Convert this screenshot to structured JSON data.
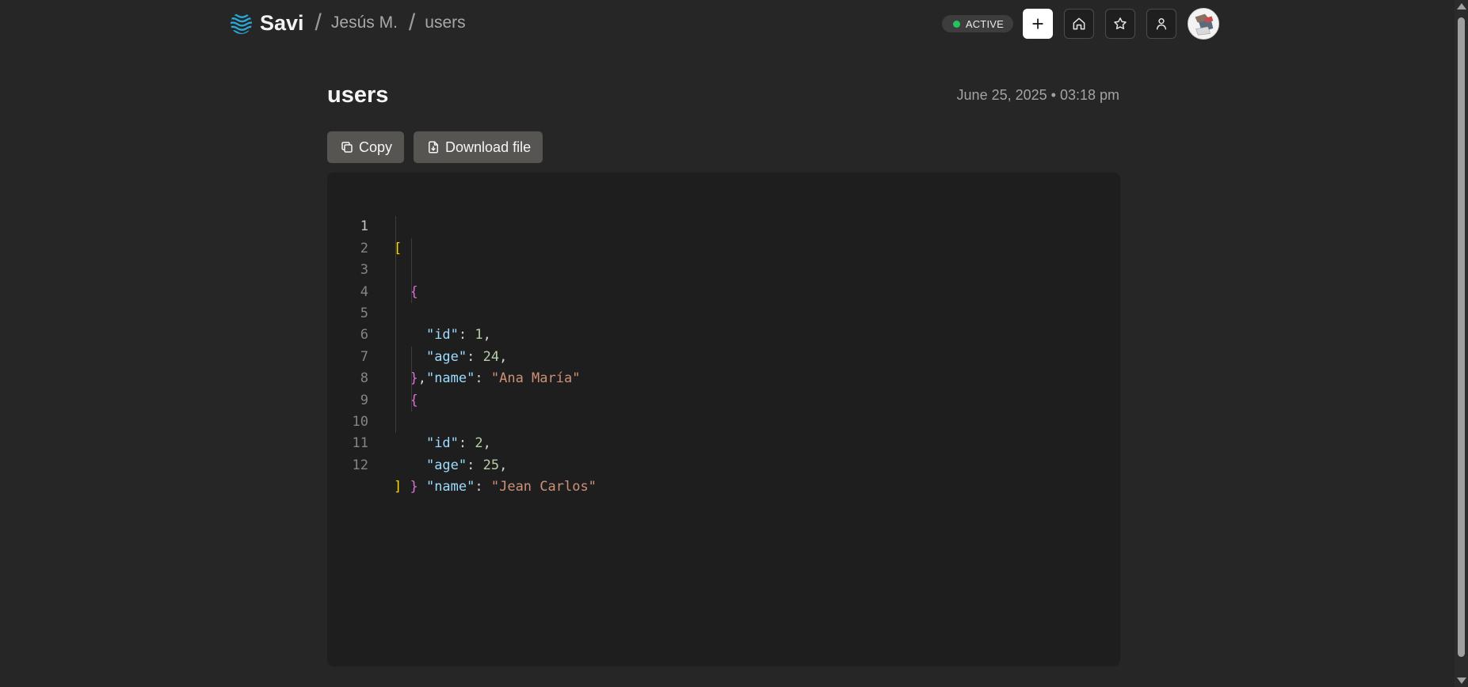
{
  "header": {
    "brand": "Savi",
    "breadcrumb": [
      "Jesús M.",
      "users"
    ],
    "status": "ACTIVE",
    "status_color": "#22c55e",
    "icons": [
      "plus-icon",
      "home-icon",
      "star-icon",
      "user-icon"
    ]
  },
  "page": {
    "title": "users",
    "timestamp": "June 25, 2025 • 03:18 pm"
  },
  "toolbar": {
    "copy_label": "Copy",
    "download_label": "Download file"
  },
  "code": {
    "line_numbers": [
      "1",
      "2",
      "3",
      "4",
      "5",
      "6",
      "7",
      "8",
      "9",
      "10",
      "11",
      "12"
    ],
    "tokens": {
      "open_array": "[",
      "close_array": "]",
      "open_obj": "{",
      "close_obj": "}",
      "comma": ",",
      "colon": ": ",
      "k_id": "\"id\"",
      "k_age": "\"age\"",
      "k_name": "\"name\"",
      "v_id_1": "1",
      "v_age_1": "24",
      "v_name_1": "\"Ana María\"",
      "v_id_2": "2",
      "v_age_2": "25",
      "v_name_2": "\"Jean Carlos\""
    }
  }
}
